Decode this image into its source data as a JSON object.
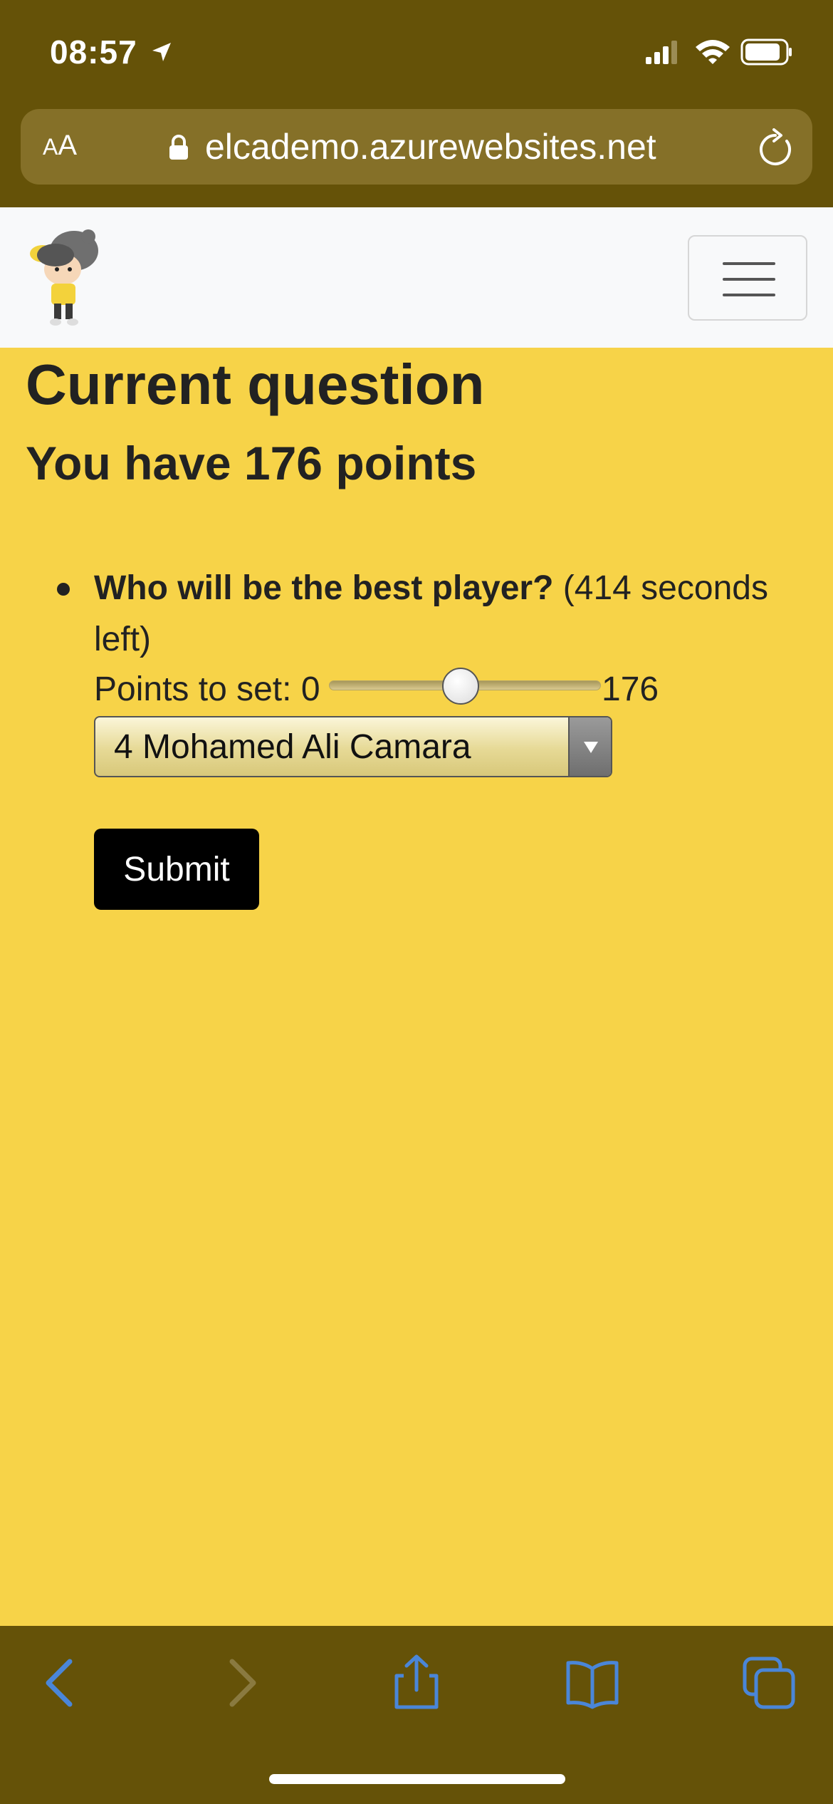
{
  "status_bar": {
    "time": "08:57"
  },
  "address_bar": {
    "aa_label_small": "A",
    "aa_label_large": "A",
    "url": "elcademo.azurewebsites.net"
  },
  "main": {
    "title": "Current question",
    "points_text": "You have 176 points",
    "question": {
      "text": "Who will be the best player?",
      "time_left": "(414 seconds left)"
    },
    "points_to_set": {
      "label": "Points to set: 0",
      "max_label": "176",
      "min": 0,
      "max": 176,
      "value": 88
    },
    "player_select": {
      "selected": "4 Mohamed Ali Camara"
    },
    "submit_label": "Submit"
  },
  "colors": {
    "page_background": "#f7d348",
    "chrome_background": "#655208",
    "navbar_background": "#f8f9fa",
    "toolbar_icon": "#4a86d8"
  }
}
